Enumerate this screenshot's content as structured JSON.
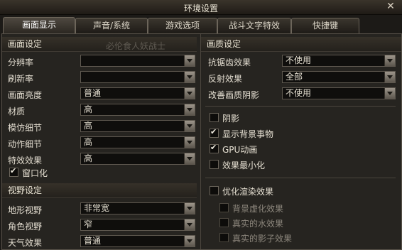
{
  "window": {
    "title": "环境设置"
  },
  "tabs": [
    {
      "label": "画面显示",
      "active": true
    },
    {
      "label": "声音/系统"
    },
    {
      "label": "游戏选项"
    },
    {
      "label": "战斗文字特效"
    },
    {
      "label": "快捷键"
    }
  ],
  "watermark": "必伦食人妖战士",
  "left": {
    "screen_section": "画面设定",
    "rows": [
      {
        "label": "分辨率",
        "value": ""
      },
      {
        "label": "刷新率",
        "value": ""
      },
      {
        "label": "画面亮度",
        "value": "普通"
      },
      {
        "label": "材质",
        "value": "高"
      },
      {
        "label": "模仿细节",
        "value": "高"
      },
      {
        "label": "动作细节",
        "value": "高"
      },
      {
        "label": "特效效果",
        "value": "高"
      }
    ],
    "windowed": {
      "label": "窗口化",
      "checked": true
    },
    "view_section": "视野设定",
    "view_rows": [
      {
        "label": "地形视野",
        "value": "非常宽"
      },
      {
        "label": "角色视野",
        "value": "窄"
      },
      {
        "label": "天气效果",
        "value": "普通"
      }
    ]
  },
  "right": {
    "quality_section": "画质设定",
    "rows": [
      {
        "label": "抗锯齿效果",
        "value": "不使用"
      },
      {
        "label": "反射效果",
        "value": "全部"
      },
      {
        "label": "改善画质阴影",
        "value": "不使用"
      }
    ],
    "checks": [
      {
        "label": "阴影",
        "checked": false
      },
      {
        "label": "显示背景事物",
        "checked": true
      },
      {
        "label": "GPU动画",
        "checked": true
      },
      {
        "label": "效果最小化",
        "checked": false
      }
    ],
    "optimize": {
      "label": "优化渲染效果",
      "checked": false
    },
    "sub_checks": [
      {
        "label": "背景虚化效果",
        "checked": false
      },
      {
        "label": "真实的水效果",
        "checked": false
      },
      {
        "label": "真实的影子效果",
        "checked": false
      }
    ]
  }
}
